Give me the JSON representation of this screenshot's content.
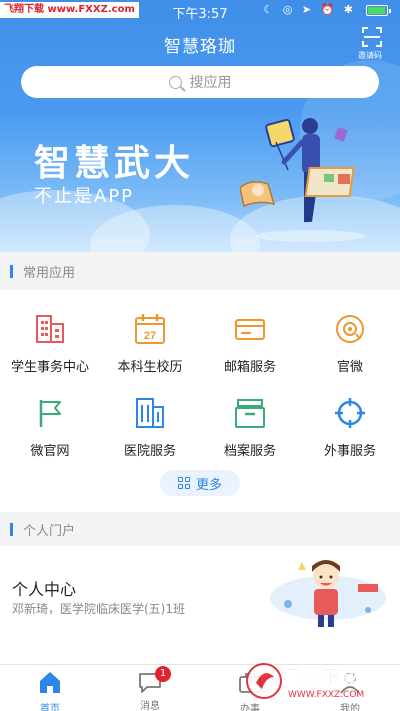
{
  "status_bar": {
    "watermark": "飞翔下载 www.FXXZ.com",
    "time": "下午3:57"
  },
  "header": {
    "title": "智慧珞珈",
    "scan_label": "邀请码"
  },
  "search": {
    "placeholder": "搜应用"
  },
  "banner": {
    "slogan_main": "智慧武大",
    "slogan_sub": "不止是APP"
  },
  "common_apps": {
    "section_title": "常用应用",
    "items": [
      {
        "label": "学生事务中心",
        "icon": "building-icon",
        "color": "#e8595a"
      },
      {
        "label": "本科生校历",
        "icon": "calendar-icon",
        "color": "#f0962f"
      },
      {
        "label": "邮箱服务",
        "icon": "card-icon",
        "color": "#f0962f"
      },
      {
        "label": "官微",
        "icon": "wechat-official-icon",
        "color": "#f0962f"
      },
      {
        "label": "微官网",
        "icon": "flag-icon",
        "color": "#3aaa7a"
      },
      {
        "label": "医院服务",
        "icon": "hospital-building-icon",
        "color": "#2d86e8"
      },
      {
        "label": "档案服务",
        "icon": "archive-box-icon",
        "color": "#3aaa7a"
      },
      {
        "label": "外事服务",
        "icon": "crosshair-icon",
        "color": "#2d86e8"
      }
    ],
    "more_label": "更多"
  },
  "personal": {
    "section_title": "个人门户",
    "name": "个人中心",
    "desc": "邓新琦，医学院临床医学(五)1班"
  },
  "tabbar": {
    "items": [
      {
        "label": "首页",
        "active": true
      },
      {
        "label": "消息",
        "badge": "1"
      },
      {
        "label": "办事"
      },
      {
        "label": "我的"
      }
    ]
  },
  "watermark_bottom": {
    "main": "飞翔下载",
    "url": "WWW.FXXZ.COM"
  },
  "colors": {
    "accent": "#2d86e8",
    "badge": "#e0242e"
  }
}
